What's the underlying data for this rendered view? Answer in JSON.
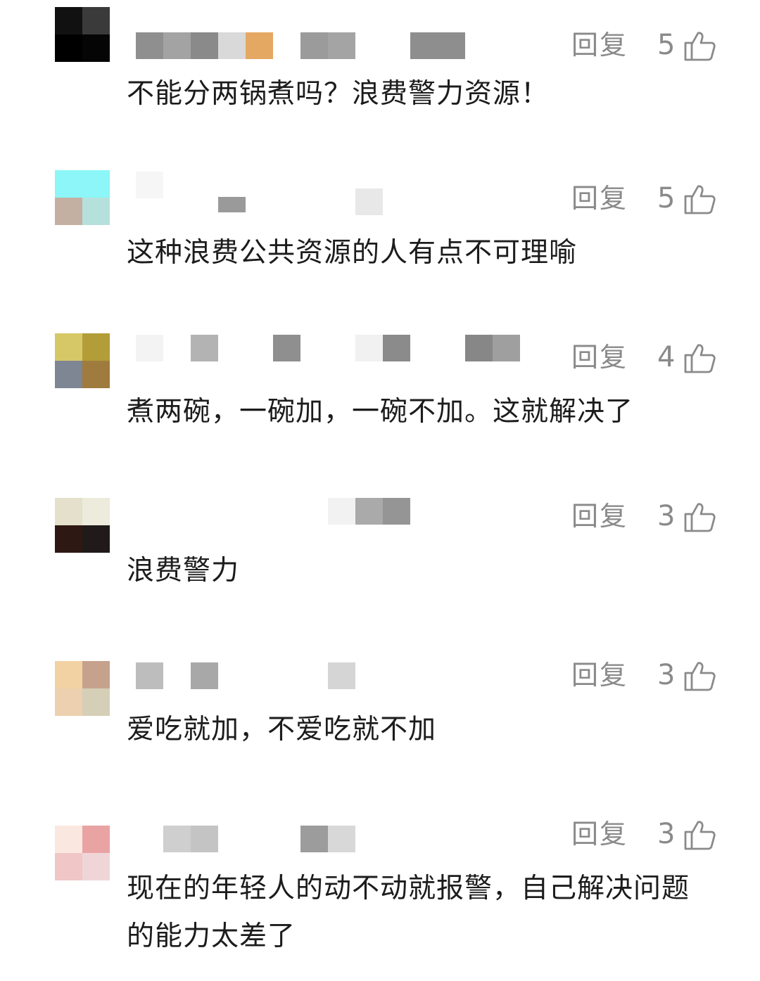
{
  "comments": [
    {
      "reply_label": "回复",
      "likes": "5",
      "text": "不能分两锅煮吗？浪费警力资源！",
      "avatar_colors": [
        "#111111",
        "#3a3a3a",
        "#000000",
        "#050505"
      ],
      "username_blur": [
        "#8f8f8f",
        "#a3a3a3",
        "#8a8a8a",
        "#d9d9d9",
        "#e5a862",
        "#9b9b9b",
        "#a4a4a4",
        "#8e8e8e"
      ]
    },
    {
      "reply_label": "回复",
      "likes": "5",
      "text": "这种浪费公共资源的人有点不可理喻",
      "avatar_colors": [
        "#8cf6f8",
        "#8cf6f8",
        "#c4b0a2",
        "#b6e0dc"
      ],
      "username_blur": [
        "#f6f6f6",
        "#9a9a9a",
        "#e8e8e8"
      ]
    },
    {
      "reply_label": "回复",
      "likes": "4",
      "text": "煮两碗，一碗加，一碗不加。这就解决了",
      "avatar_colors": [
        "#d7c867",
        "#b39d38",
        "#7e8593",
        "#9f7c3e"
      ],
      "username_blur": [
        "#f3f3f3",
        "#b3b3b3",
        "#8f8f8f",
        "#f1f1f1",
        "#8b8b8b",
        "#878787",
        "#9f9f9f"
      ]
    },
    {
      "reply_label": "回复",
      "likes": "3",
      "text": "浪费警力",
      "avatar_colors": [
        "#e4e0cb",
        "#ecebdc",
        "#2e1813",
        "#201b1a"
      ],
      "username_blur": [
        "#f2f2f2",
        "#aaaaaa",
        "#959595"
      ]
    },
    {
      "reply_label": "回复",
      "likes": "3",
      "text": "爱吃就加，不爱吃就不加",
      "avatar_colors": [
        "#f2d2a3",
        "#c6a28c",
        "#ecd0b0",
        "#d6cfb7"
      ],
      "username_blur": [
        "#bdbdbd",
        "#a8a8a8",
        "#d5d5d5"
      ]
    },
    {
      "reply_label": "回复",
      "likes": "3",
      "text": "现在的年轻人的动不动就报警，自己解决问题的能力太差了",
      "avatar_colors": [
        "#fae8e0",
        "#eaa3a3",
        "#f1c6c6",
        "#f0d5d8"
      ],
      "username_blur": [
        "#cfcfcf",
        "#c4c4c4",
        "#9c9c9c",
        "#d8d8d8"
      ]
    }
  ]
}
